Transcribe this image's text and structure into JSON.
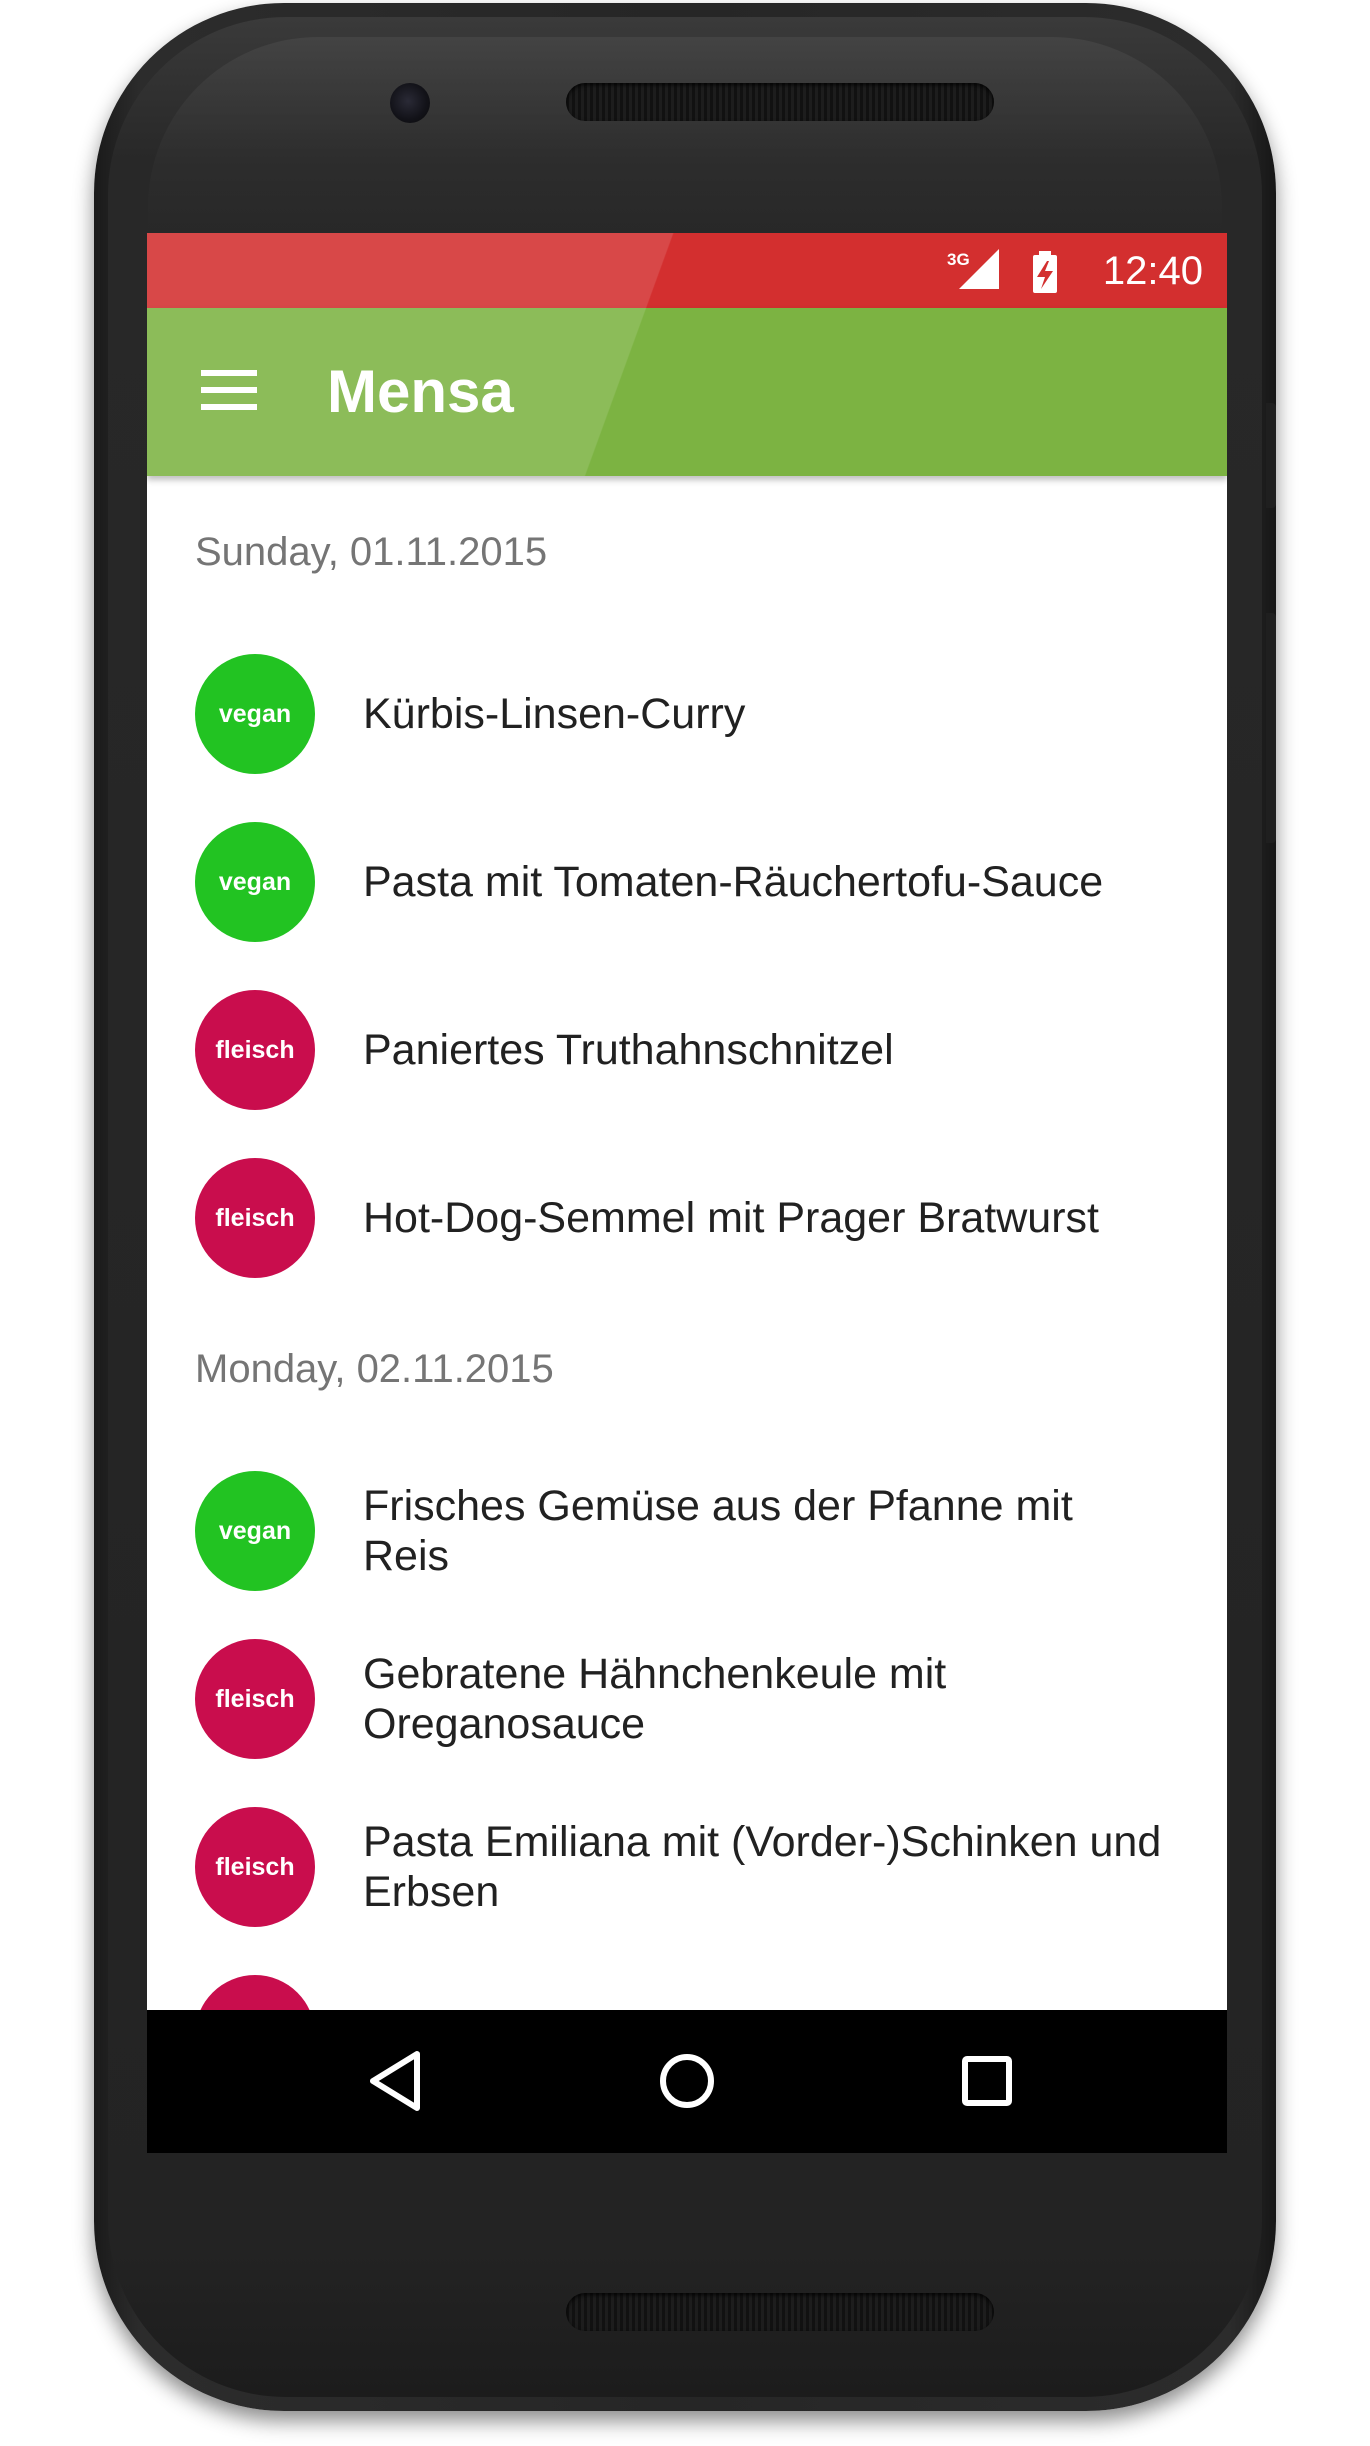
{
  "status_bar": {
    "network": "3G",
    "time": "12:40",
    "color": "#d32f2f"
  },
  "app_bar": {
    "title": "Mensa",
    "menu_icon": "hamburger-menu-icon",
    "color": "#7cb342"
  },
  "badge_colors": {
    "vegan": "#22c322",
    "fleisch": "#c90d4d"
  },
  "days": [
    {
      "date": "Sunday, 01.11.2015",
      "meals": [
        {
          "type": "vegan",
          "name": "Kürbis-Linsen-Curry"
        },
        {
          "type": "vegan",
          "name": "Pasta mit Tomaten-Räuchertofu-Sauce"
        },
        {
          "type": "fleisch",
          "name": "Paniertes Truthahnschnitzel"
        },
        {
          "type": "fleisch",
          "name": "Hot-Dog-Semmel mit Prager Bratwurst"
        }
      ]
    },
    {
      "date": "Monday, 02.11.2015",
      "meals": [
        {
          "type": "vegan",
          "name": "Frisches Gemüse aus der Pfanne mit Reis"
        },
        {
          "type": "fleisch",
          "name": "Gebratene Hähnchenkeule mit Oreganosauce"
        },
        {
          "type": "fleisch",
          "name": "Pasta Emiliana mit (Vorder-)Schinken und Erbsen"
        },
        {
          "type": "fleisch",
          "name": ""
        }
      ]
    }
  ],
  "nav_bar": {
    "back_icon": "back-triangle-icon",
    "home_icon": "home-circle-icon",
    "recents_icon": "recents-square-icon"
  }
}
